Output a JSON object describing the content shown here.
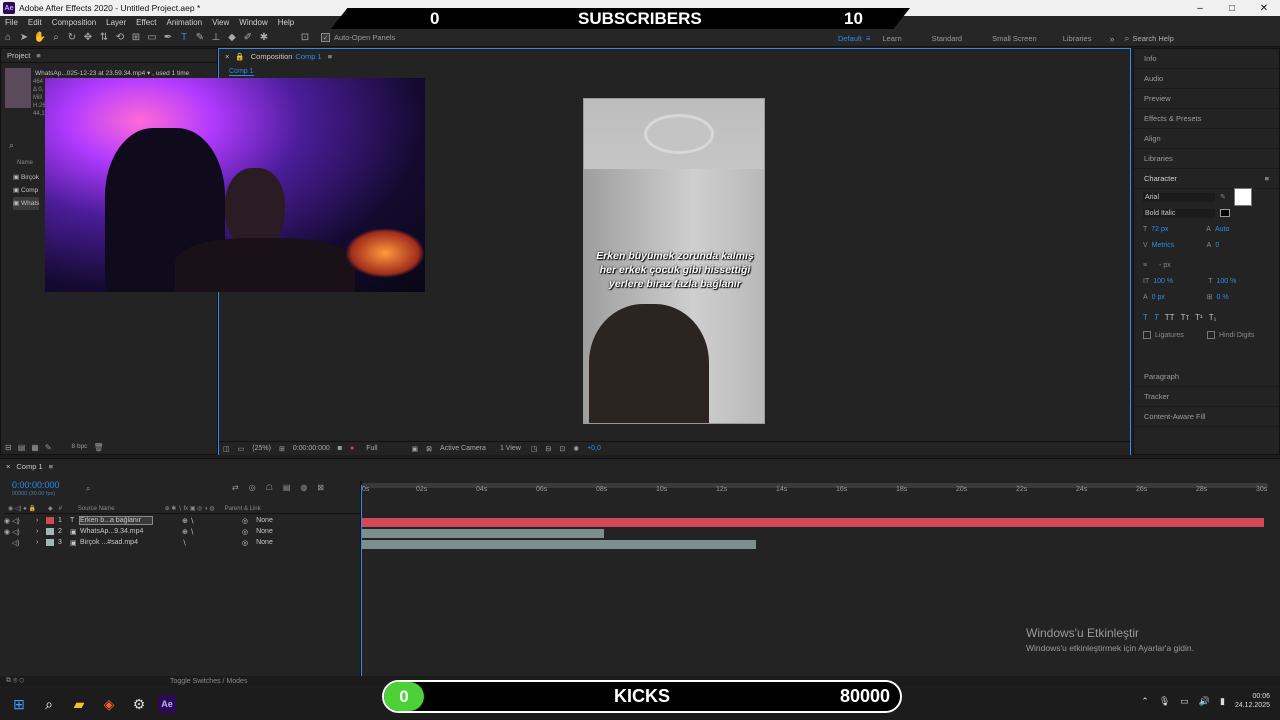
{
  "titlebar": {
    "app_icon": "Ae",
    "title": "Adobe After Effects 2020 - Untitled Project.aep *",
    "controls": [
      "–",
      "□",
      "✕"
    ]
  },
  "subscribers": {
    "left": "0",
    "label": "SUBSCRIBERS",
    "right": "10"
  },
  "menu": [
    "File",
    "Edit",
    "Composition",
    "Layer",
    "Effect",
    "Animation",
    "View",
    "Window",
    "Help"
  ],
  "toolbar": {
    "auto_open_label": "Auto-Open Panels",
    "workspaces": [
      "Default",
      "Learn",
      "Standard",
      "Small Screen",
      "Libraries"
    ],
    "search_help": "Search Help"
  },
  "project": {
    "header": "Project",
    "file_line": "WhatsAp...025-12-23 at 23.59.34.mp4 ▾ , used 1 time",
    "meta": [
      "464",
      "Δ 0,",
      "Mill",
      "H.26",
      "44,1"
    ],
    "name_col": "Name",
    "items": [
      "Birçok",
      "Comp",
      "Whats"
    ],
    "bpc": "8 bpc"
  },
  "comp_panel": {
    "header_label": "Composition",
    "header_comp": "Comp 1",
    "tab": "Comp 1",
    "caption": "Erken büyümek zorunda kalmış her erkek çocuk gibi hissettiği yerlere biraz fazla bağlanır",
    "viewer": {
      "zoom": "(25%)",
      "time": "0:00:00:000",
      "resolution": "Full",
      "camera": "Active Camera",
      "views": "1 View",
      "exposure": "+0,0"
    }
  },
  "right_panel": {
    "items_top": [
      "Info",
      "Audio",
      "Preview",
      "Effects & Presets",
      "Align",
      "Libraries"
    ],
    "character": {
      "header": "Character",
      "font": "Arial",
      "style": "Bold Italic",
      "size": "72 px",
      "leading": "Auto",
      "kerning": "Metrics",
      "tracking": "0",
      "stroke": "- px",
      "v_scale": "100 %",
      "h_scale": "100 %",
      "baseline": "0 px",
      "tsume": "0 %",
      "ligatures": "Ligatures",
      "hindi_digits": "Hindi Digits"
    },
    "items_bottom": [
      "Paragraph",
      "Tracker",
      "Content-Aware Fill"
    ]
  },
  "timeline": {
    "tab": "Comp 1",
    "timecode": "0:00:00:000",
    "fps": "00000 (30.00 fps)",
    "columns": {
      "source": "Source Name",
      "parent": "Parent & Link"
    },
    "ruler": [
      "0s",
      "02s",
      "04s",
      "06s",
      "08s",
      "10s",
      "12s",
      "14s",
      "16s",
      "18s",
      "20s",
      "22s",
      "24s",
      "26s",
      "28s",
      "30s"
    ],
    "layers": [
      {
        "num": "1",
        "type": "T",
        "name": "Erken b...a bağlanır",
        "parent": "None",
        "color": "#d14857"
      },
      {
        "num": "2",
        "type": "▣",
        "name": "WhatsAp...9.34.mp4",
        "parent": "None",
        "color": "#9fb8b3"
      },
      {
        "num": "3",
        "type": "▣",
        "name": "Birçok ...#sad.mp4",
        "parent": "None",
        "color": "#9fb8b3"
      }
    ],
    "toggle_label": "Toggle Switches / Modes"
  },
  "watermark": {
    "line1": "Windows'u Etkinleştir",
    "line2": "Windows'u etkinleştirmek için Ayarlar'a gidin."
  },
  "kicks": {
    "left": "0",
    "label": "KICKS",
    "right": "80000"
  },
  "taskbar": {
    "time": "00:06",
    "date": "24.12.2025"
  },
  "colors": {
    "accent": "#2d8ceb",
    "layer_text": "#d14857",
    "layer_video": "#9fb8b3"
  }
}
